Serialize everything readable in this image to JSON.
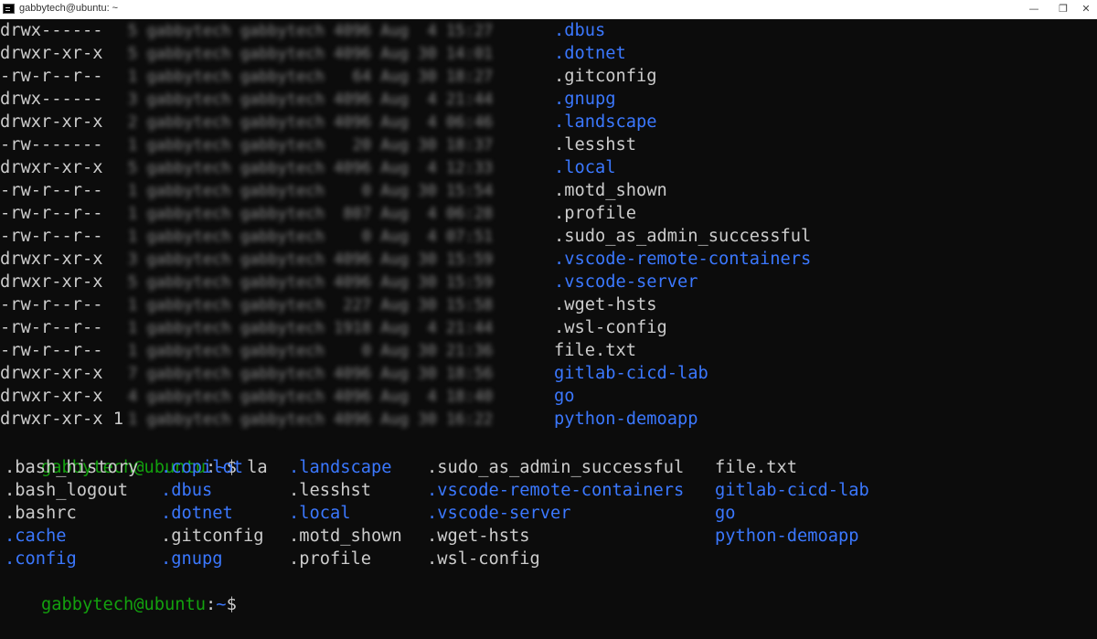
{
  "window": {
    "title": "gabbytech@ubuntu: ~",
    "minimize": "—",
    "maximize": "❐",
    "close": "✕"
  },
  "listing": [
    {
      "perm": "drwx------",
      "meta": "5 gabbytech gabbytech 4096 Aug  4 15:27",
      "name": ".dbus",
      "kind": "dir"
    },
    {
      "perm": "drwxr-xr-x",
      "meta": "5 gabbytech gabbytech 4096 Aug 30 14:01",
      "name": ".dotnet",
      "kind": "dir"
    },
    {
      "perm": "-rw-r--r--",
      "meta": "1 gabbytech gabbytech   64 Aug 30 18:27",
      "name": ".gitconfig",
      "kind": "file"
    },
    {
      "perm": "drwx------",
      "meta": "3 gabbytech gabbytech 4096 Aug  4 21:44",
      "name": ".gnupg",
      "kind": "dir"
    },
    {
      "perm": "drwxr-xr-x",
      "meta": "2 gabbytech gabbytech 4096 Aug  4 06:46",
      "name": ".landscape",
      "kind": "dir"
    },
    {
      "perm": "-rw-------",
      "meta": "1 gabbytech gabbytech   20 Aug 30 18:37",
      "name": ".lesshst",
      "kind": "file"
    },
    {
      "perm": "drwxr-xr-x",
      "meta": "5 gabbytech gabbytech 4096 Aug  4 12:33",
      "name": ".local",
      "kind": "dir"
    },
    {
      "perm": "-rw-r--r--",
      "meta": "1 gabbytech gabbytech    0 Aug 30 15:54",
      "name": ".motd_shown",
      "kind": "file"
    },
    {
      "perm": "-rw-r--r--",
      "meta": "1 gabbytech gabbytech  807 Aug  4 06:28",
      "name": ".profile",
      "kind": "file"
    },
    {
      "perm": "-rw-r--r--",
      "meta": "1 gabbytech gabbytech    0 Aug  4 07:51",
      "name": ".sudo_as_admin_successful",
      "kind": "file"
    },
    {
      "perm": "drwxr-xr-x",
      "meta": "3 gabbytech gabbytech 4096 Aug 30 15:59",
      "name": ".vscode-remote-containers",
      "kind": "dir"
    },
    {
      "perm": "drwxr-xr-x",
      "meta": "5 gabbytech gabbytech 4096 Aug 30 15:59",
      "name": ".vscode-server",
      "kind": "dir"
    },
    {
      "perm": "-rw-r--r--",
      "meta": "1 gabbytech gabbytech  227 Aug 30 15:58",
      "name": ".wget-hsts",
      "kind": "file"
    },
    {
      "perm": "-rw-r--r--",
      "meta": "1 gabbytech gabbytech 1918 Aug  4 21:44",
      "name": ".wsl-config",
      "kind": "file"
    },
    {
      "perm": "-rw-r--r--",
      "meta": "1 gabbytech gabbytech    0 Aug 30 21:36",
      "name": "file.txt",
      "kind": "file"
    },
    {
      "perm": "drwxr-xr-x",
      "meta": "7 gabbytech gabbytech 4096 Aug 30 18:56",
      "name": "gitlab-cicd-lab",
      "kind": "dir"
    },
    {
      "perm": "drwxr-xr-x",
      "meta": "4 gabbytech gabbytech 4096 Aug  4 18:40",
      "name": "go",
      "kind": "dir"
    },
    {
      "perm": "drwxr-xr-x 1",
      "meta": "1 gabbytech gabbytech 4096 Aug 30 16:22",
      "name": "python-demoapp",
      "kind": "dir"
    }
  ],
  "prompt": {
    "user_host": "gabbytech@ubuntu",
    "colon": ":",
    "path": "~",
    "symbol": "$ ",
    "command": "la"
  },
  "la_columns": [
    [
      {
        "name": ".bash_history",
        "kind": "file"
      },
      {
        "name": ".bash_logout",
        "kind": "file"
      },
      {
        "name": ".bashrc",
        "kind": "file"
      },
      {
        "name": ".cache",
        "kind": "dir"
      },
      {
        "name": ".config",
        "kind": "dir"
      }
    ],
    [
      {
        "name": ".copilot",
        "kind": "dir"
      },
      {
        "name": ".dbus",
        "kind": "dir"
      },
      {
        "name": ".dotnet",
        "kind": "dir"
      },
      {
        "name": ".gitconfig",
        "kind": "file"
      },
      {
        "name": ".gnupg",
        "kind": "dir"
      }
    ],
    [
      {
        "name": ".landscape",
        "kind": "dir"
      },
      {
        "name": ".lesshst",
        "kind": "file"
      },
      {
        "name": ".local",
        "kind": "dir"
      },
      {
        "name": ".motd_shown",
        "kind": "file"
      },
      {
        "name": ".profile",
        "kind": "file"
      }
    ],
    [
      {
        "name": ".sudo_as_admin_successful",
        "kind": "file"
      },
      {
        "name": ".vscode-remote-containers",
        "kind": "dir"
      },
      {
        "name": ".vscode-server",
        "kind": "dir"
      },
      {
        "name": ".wget-hsts",
        "kind": "file"
      },
      {
        "name": ".wsl-config",
        "kind": "file"
      }
    ],
    [
      {
        "name": "file.txt",
        "kind": "file"
      },
      {
        "name": "gitlab-cicd-lab",
        "kind": "dir"
      },
      {
        "name": "go",
        "kind": "dir"
      },
      {
        "name": "python-demoapp",
        "kind": "dir"
      }
    ]
  ],
  "colors": {
    "background": "#0c0c0c",
    "text": "#cccccc",
    "directory": "#3b78ff",
    "prompt_host": "#13a10e"
  }
}
